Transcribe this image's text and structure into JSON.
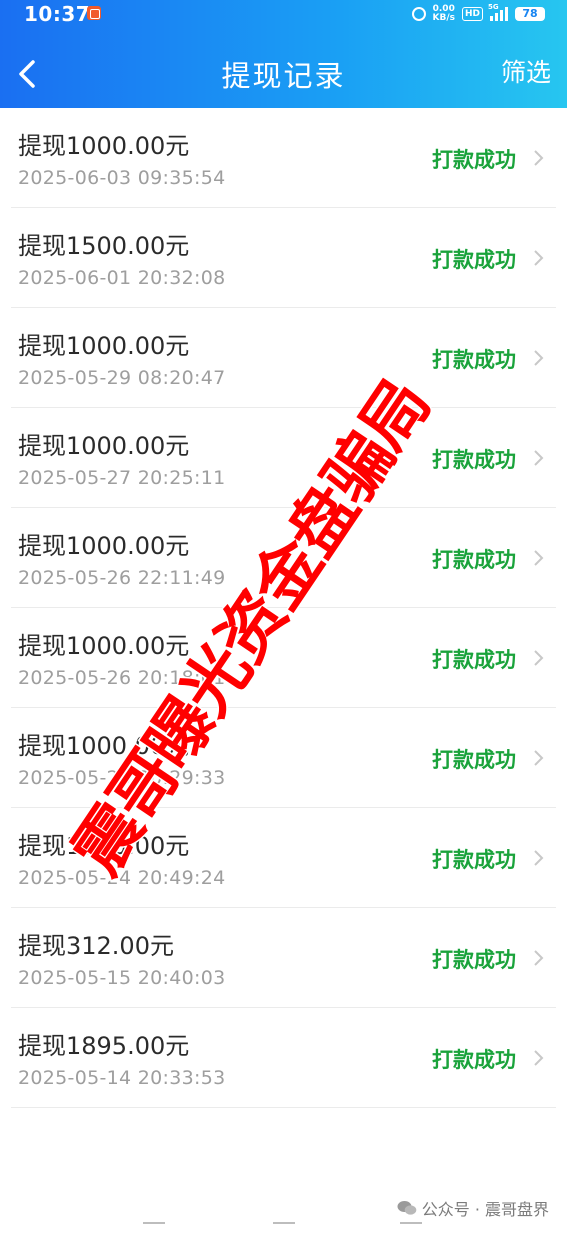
{
  "status_bar": {
    "time": "10:37",
    "speed_value": "0.00",
    "speed_unit": "KB/s",
    "hd_label": "HD",
    "network_label": "5G",
    "battery": "78"
  },
  "header": {
    "title": "提现记录",
    "filter_label": "筛选"
  },
  "records": [
    {
      "amount": "提现1000.00元",
      "date": "2025-06-03 09:35:54",
      "status": "打款成功"
    },
    {
      "amount": "提现1500.00元",
      "date": "2025-06-01 20:32:08",
      "status": "打款成功"
    },
    {
      "amount": "提现1000.00元",
      "date": "2025-05-29 08:20:47",
      "status": "打款成功"
    },
    {
      "amount": "提现1000.00元",
      "date": "2025-05-27 20:25:11",
      "status": "打款成功"
    },
    {
      "amount": "提现1000.00元",
      "date": "2025-05-26 22:11:49",
      "status": "打款成功"
    },
    {
      "amount": "提现1000.00元",
      "date": "2025-05-26 20:18:01",
      "status": "打款成功"
    },
    {
      "amount": "提现1000.00元",
      "date": "2025-05-25 20:29:33",
      "status": "打款成功"
    },
    {
      "amount": "提现1000.00元",
      "date": "2025-05-24 20:49:24",
      "status": "打款成功"
    },
    {
      "amount": "提现312.00元",
      "date": "2025-05-15 20:40:03",
      "status": "打款成功"
    },
    {
      "amount": "提现1895.00元",
      "date": "2025-05-14 20:33:53",
      "status": "打款成功"
    }
  ],
  "watermark": {
    "text": "震哥曝光资金盘骗局",
    "color": "#ff0000"
  },
  "footer": {
    "source": "公众号 · 震哥盘界"
  },
  "colors": {
    "header_start": "#1a6ff2",
    "header_end": "#27c6f0",
    "success": "#1aa33b"
  }
}
